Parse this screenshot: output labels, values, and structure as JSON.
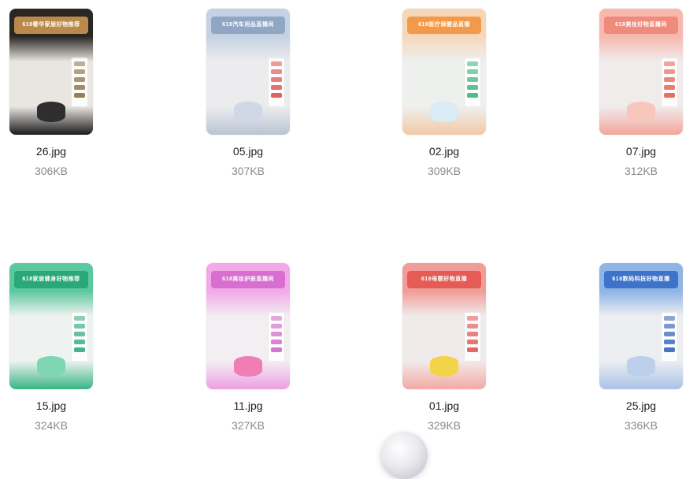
{
  "files": [
    {
      "name": "26.jpg",
      "size": "306KB",
      "icon": "thumbnail-image-icon",
      "banner": "618奢华家居好物推荐",
      "colors": {
        "bg_top": "#2a2623",
        "bg_bottom": "#e9e6e2",
        "banner": "#b98a4a",
        "stage": "#1b1b1b",
        "panel": "#8b6a3e",
        "prod": "#2e2e2e"
      }
    },
    {
      "name": "05.jpg",
      "size": "307KB",
      "icon": "thumbnail-image-icon",
      "banner": "618汽车用品直播间",
      "colors": {
        "bg_top": "#c5d2e3",
        "bg_bottom": "#ececef",
        "banner": "#8fa6c4",
        "stage": "#b9c4d3",
        "panel": "#e04a4a",
        "prod": "#cfd8e4"
      }
    },
    {
      "name": "02.jpg",
      "size": "309KB",
      "icon": "thumbnail-image-icon",
      "banner": "618医疗保健品直播",
      "colors": {
        "bg_top": "#f6d7b9",
        "bg_bottom": "#eef0ee",
        "banner": "#f39a4a",
        "stage": "#f2c9a6",
        "panel": "#2fb47a",
        "prod": "#d9ecf5"
      }
    },
    {
      "name": "07.jpg",
      "size": "312KB",
      "icon": "thumbnail-image-icon",
      "banner": "618美妆好物直播间",
      "colors": {
        "bg_top": "#f7b8ae",
        "bg_bottom": "#f0ecec",
        "banner": "#f08a7c",
        "stage": "#f3a59b",
        "panel": "#e35a4b",
        "prod": "#f7c7bd"
      }
    },
    {
      "name": "15.jpg",
      "size": "324KB",
      "icon": "thumbnail-image-icon",
      "banner": "618家居健身好物推荐",
      "colors": {
        "bg_top": "#5cc8a0",
        "bg_bottom": "#eef2f0",
        "banner": "#2ba879",
        "stage": "#39b585",
        "panel": "#2ba879",
        "prod": "#7fd6b3"
      }
    },
    {
      "name": "11.jpg",
      "size": "327KB",
      "icon": "thumbnail-image-icon",
      "banner": "618美妆护肤直播间",
      "colors": {
        "bg_top": "#f3a8e8",
        "bg_bottom": "#f2eef2",
        "banner": "#d86fd0",
        "stage": "#ee9fe2",
        "panel": "#cf63c9",
        "prod": "#f07eb5"
      }
    },
    {
      "name": "01.jpg",
      "size": "329KB",
      "icon": "thumbnail-image-icon",
      "banner": "618母婴好物直播",
      "colors": {
        "bg_top": "#f19c97",
        "bg_bottom": "#f0ebea",
        "banner": "#e55c56",
        "stage": "#f3aaa4",
        "panel": "#e0504a",
        "prod": "#f2d34a"
      }
    },
    {
      "name": "25.jpg",
      "size": "336KB",
      "icon": "thumbnail-image-icon",
      "banner": "618数码科技好物直播",
      "colors": {
        "bg_top": "#8fb4e6",
        "bg_bottom": "#eceef2",
        "banner": "#3f73c9",
        "stage": "#a9c3e6",
        "panel": "#2f5fb8",
        "prod": "#bcd0ec"
      }
    }
  ]
}
